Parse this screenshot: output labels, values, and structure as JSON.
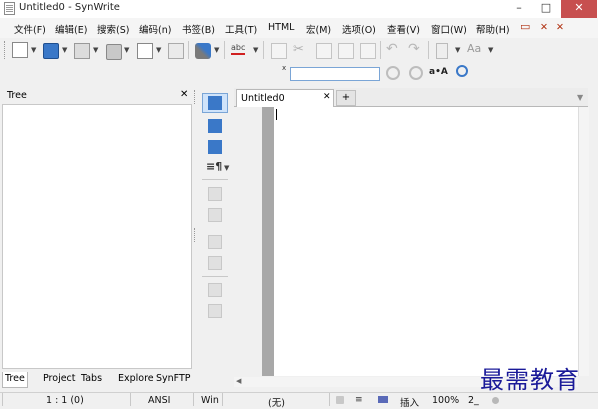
{
  "window": {
    "title": "Untitled0 - SynWrite",
    "minimize": "–",
    "maximize": "□",
    "close": "✕"
  },
  "menu": [
    "文件(F)",
    "编辑(E)",
    "搜索(S)",
    "编码(n)",
    "书签(B)",
    "工具(T)",
    "HTML",
    "宏(M)",
    "选项(O)",
    "查看(V)",
    "窗口(W)",
    "帮助(H)"
  ],
  "menu_extras": {
    "restore": "▭",
    "close": "✕",
    "pin": "✕"
  },
  "toolbar": {
    "spell_label": "abc",
    "font_label": "Aa",
    "case_label": "a•A",
    "search_value": "",
    "search_marker": "x"
  },
  "tree_panel": {
    "title": "Tree",
    "close": "✕"
  },
  "bottom_tabs": [
    "Tree",
    "Project",
    "Tabs",
    "Explore",
    "SynFTP"
  ],
  "editor": {
    "tab_label": "Untitled0",
    "tab_close": "✕",
    "add_tab": "+",
    "tabs_menu": "▼"
  },
  "status": {
    "position": "1 : 1 (0)",
    "encoding": "ANSI",
    "line_ending": "Win",
    "lexer": "(无)",
    "mode": "插入",
    "zoom": "100%",
    "extra": "2_"
  },
  "watermark": "最需教育",
  "colors": {
    "accent": "#3a78c8",
    "gutter": "#a8a8a8",
    "close": "#c74f4f",
    "watermark": "#1a1a99"
  }
}
